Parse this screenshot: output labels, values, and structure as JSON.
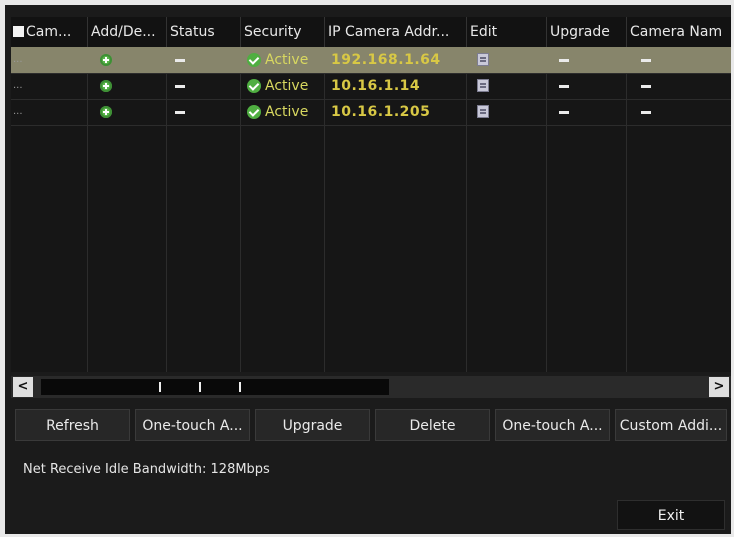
{
  "table": {
    "headers": [
      "Cam...",
      "Add/De...",
      "Status",
      "Security",
      "IP Camera Addr...",
      "Edit",
      "Upgrade",
      "Camera Nam"
    ],
    "rows": [
      {
        "index": "...",
        "security": "Active",
        "ip": "192.168.1.64",
        "selected": true
      },
      {
        "index": "...",
        "security": "Active",
        "ip": "10.16.1.14",
        "selected": false
      },
      {
        "index": "...",
        "security": "Active",
        "ip": "10.16.1.205",
        "selected": false
      }
    ]
  },
  "scrollbar": {
    "left_arrow": "<",
    "right_arrow": ">"
  },
  "buttons": {
    "refresh": "Refresh",
    "one_touch_activate": "One-touch A...",
    "upgrade": "Upgrade",
    "delete": "Delete",
    "one_touch_adding": "One-touch A...",
    "custom_adding": "Custom Addi..."
  },
  "footer": {
    "bandwidth": "Net Receive Idle Bandwidth: 128Mbps",
    "exit": "Exit"
  },
  "colors": {
    "selected_row": "#87856b",
    "ip_text": "#d8c845",
    "active_text": "#d8d860",
    "add_icon": "#59b54a",
    "check_icon": "#4fae41"
  },
  "icons": [
    "add-icon",
    "check-icon",
    "edit-icon",
    "dash-icon",
    "checkbox-icon"
  ]
}
